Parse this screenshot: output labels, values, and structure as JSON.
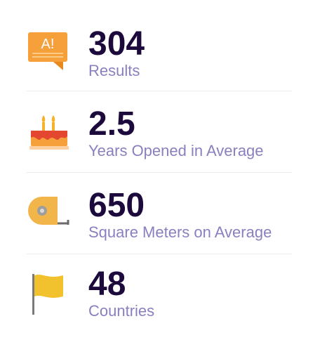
{
  "colors": {
    "value": "#1c0a3d",
    "label": "#8a7fbf",
    "divider": "#ececf1",
    "orange": "#f5a03a",
    "yellow": "#f2c12e"
  },
  "stats": [
    {
      "icon": "speech-bubble-alert-icon",
      "value": "304",
      "label": "Results"
    },
    {
      "icon": "birthday-cake-icon",
      "value": "2.5",
      "label": "Years Opened in Average"
    },
    {
      "icon": "tape-measure-icon",
      "value": "650",
      "label": "Square Meters on Average"
    },
    {
      "icon": "flag-icon",
      "value": "48",
      "label": "Countries"
    }
  ],
  "icon_text": {
    "speech_bubble": "A!"
  }
}
